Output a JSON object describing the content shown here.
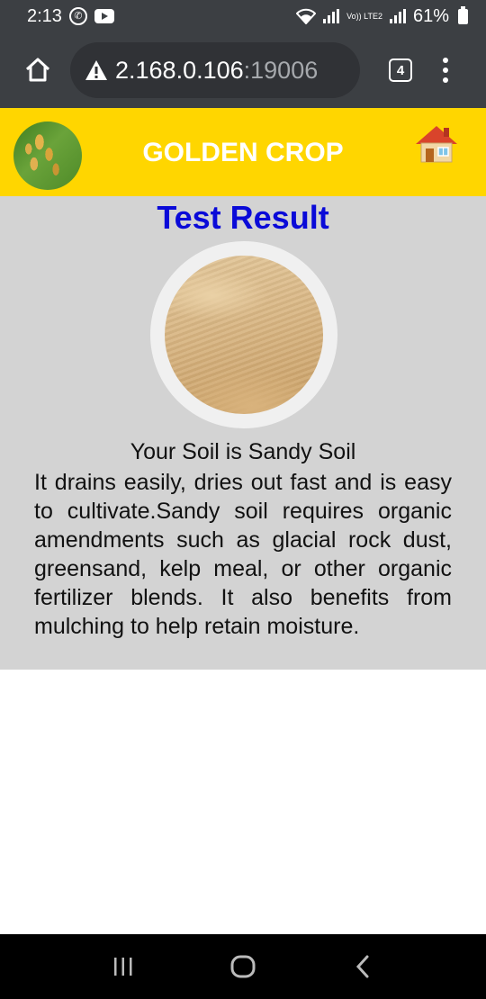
{
  "status_bar": {
    "time": "2:13",
    "battery": "61%",
    "network_label": "Vo)) LTE2"
  },
  "browser": {
    "url_host": "2.168.0.106",
    "url_port": ":19006",
    "tab_count": "4"
  },
  "header": {
    "title": "GOLDEN CROP",
    "logo_icon": "rice-crop-logo",
    "home_icon": "house-icon",
    "background_color": "#ffd600",
    "title_color": "#ffffff"
  },
  "result": {
    "page_title": "Test Result",
    "soil_type": "Your Soil is Sandy Soil",
    "description": "It drains easily, dries out fast and is easy to cultivate.Sandy soil requires organic amendments such as glacial rock dust, greensand, kelp meal, or other organic fertilizer blends. It also benefits from mulching to help retain moisture.",
    "title_color": "#0a0ad8",
    "panel_color": "#d3d3d3"
  },
  "nav": {
    "recents_icon": "recent-apps-icon",
    "home_icon": "home-circle-icon",
    "back_icon": "back-chevron-icon"
  }
}
